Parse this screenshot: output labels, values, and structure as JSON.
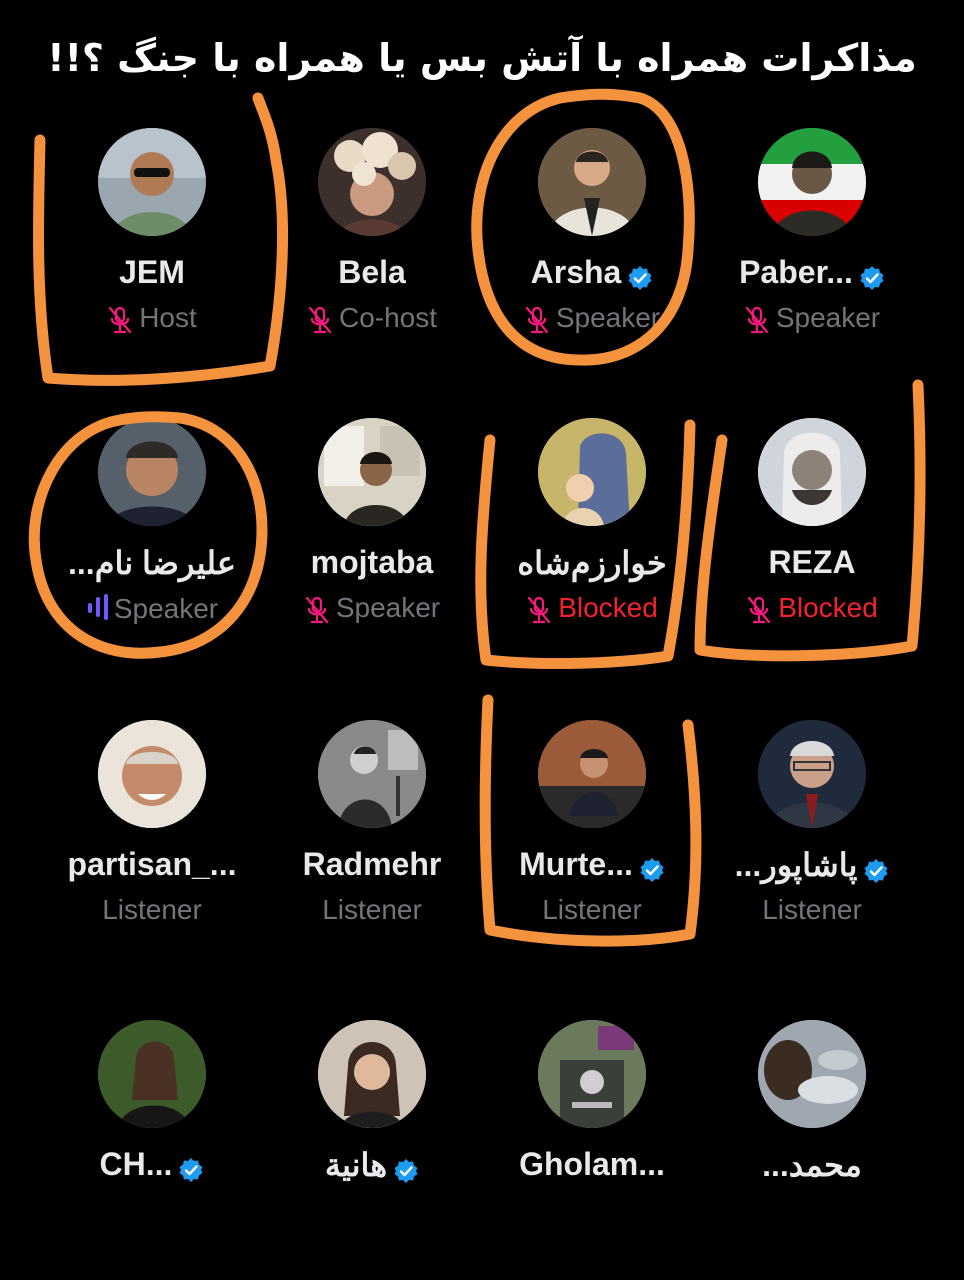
{
  "title": "مذاکرات همراه با آتش بس یا همراه با جنگ ؟!!",
  "colors": {
    "background": "#000000",
    "name": "#e7e9ea",
    "role": "#71767b",
    "blocked": "#f4212e",
    "mic_muted": "#f91880",
    "verified": "#1d9bf0",
    "annotation": "#f5923e",
    "speaking_bars": "#7856ff"
  },
  "participants": [
    {
      "name": "JEM",
      "role": "Host",
      "verified": false,
      "mic": "muted",
      "avatar": "man-sunglasses"
    },
    {
      "name": "Bela",
      "role": "Co-host",
      "verified": false,
      "mic": "muted",
      "avatar": "woman-flowers"
    },
    {
      "name": "Arsha",
      "role": "Speaker",
      "verified": true,
      "mic": "muted",
      "avatar": "man-suit"
    },
    {
      "name": "Paber...",
      "role": "Speaker",
      "verified": true,
      "mic": "muted",
      "avatar": "man-flag"
    },
    {
      "name": "علیرضا نام...",
      "role": "Speaker",
      "verified": false,
      "mic": "speaking",
      "avatar": "man-smiling"
    },
    {
      "name": "mojtaba",
      "role": "Speaker",
      "verified": false,
      "mic": "muted",
      "avatar": "man-poster"
    },
    {
      "name": "خوارزم‌شاه",
      "role": "Blocked",
      "verified": false,
      "mic": "muted",
      "avatar": "madonna-painting"
    },
    {
      "name": "REZA",
      "role": "Blocked",
      "verified": false,
      "mic": "muted",
      "avatar": "witcher"
    },
    {
      "name": "partisan_...",
      "role": "Listener",
      "verified": false,
      "mic": "none",
      "avatar": "old-man-smiling"
    },
    {
      "name": "Radmehr",
      "role": "Listener",
      "verified": false,
      "mic": "none",
      "avatar": "bw-speaker"
    },
    {
      "name": "Murte...",
      "role": "Listener",
      "verified": true,
      "mic": "none",
      "avatar": "man-microphone"
    },
    {
      "name": "پاشاپور...",
      "role": "Listener",
      "verified": true,
      "mic": "none",
      "avatar": "man-glasses"
    },
    {
      "name": "CH...",
      "role": "",
      "verified": true,
      "mic": "none",
      "avatar": "woman-forest"
    },
    {
      "name": "هانیة",
      "role": "",
      "verified": true,
      "mic": "none",
      "avatar": "woman-portrait"
    },
    {
      "name": "Gholam...",
      "role": "",
      "verified": false,
      "mic": "none",
      "avatar": "gravestone"
    },
    {
      "name": "محمد...",
      "role": "",
      "verified": false,
      "mic": "none",
      "avatar": "sky-clouds"
    }
  ]
}
